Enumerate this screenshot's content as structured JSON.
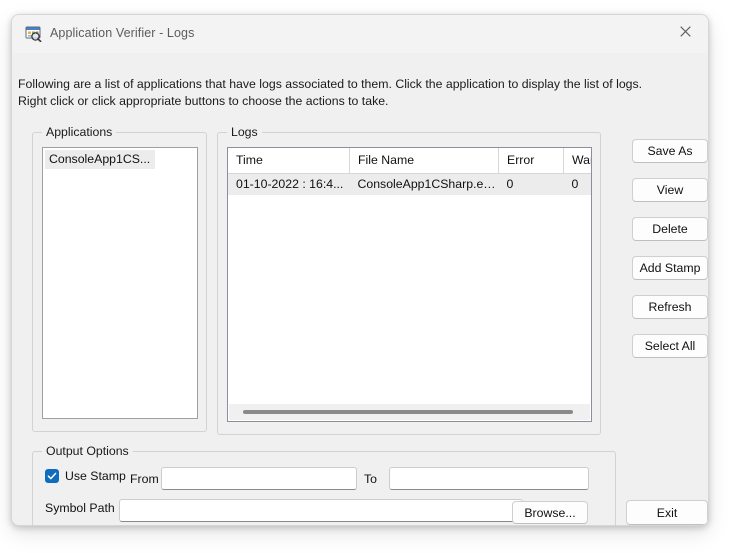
{
  "window": {
    "title": "Application Verifier - Logs",
    "icon": "application-verifier-icon",
    "close_label": "✕"
  },
  "intro": {
    "text": "Following are a list of applications that have logs associated to them. Click the application to display the list of logs. Right click or click appropriate buttons to choose the actions to take."
  },
  "applications": {
    "group_label": "Applications",
    "items": [
      {
        "label": "ConsoleApp1CS...",
        "selected": true
      }
    ]
  },
  "logs": {
    "group_label": "Logs",
    "columns": [
      "Time",
      "File Name",
      "Error",
      "Warning"
    ],
    "rows": [
      {
        "time": "01-10-2022 : 16:4...",
        "file_name": "ConsoleApp1CSharp.ex...",
        "error": "0",
        "warning": "0",
        "selected": true
      }
    ]
  },
  "side_buttons": [
    {
      "id": "save-as",
      "label": "Save As"
    },
    {
      "id": "view",
      "label": "View"
    },
    {
      "id": "delete",
      "label": "Delete"
    },
    {
      "id": "add-stamp",
      "label": "Add Stamp"
    },
    {
      "id": "refresh",
      "label": "Refresh"
    },
    {
      "id": "select-all",
      "label": "Select All"
    }
  ],
  "output_options": {
    "group_label": "Output Options",
    "use_stamp": {
      "label": "Use Stamp",
      "checked": true,
      "check_glyph": "✓"
    },
    "from": {
      "label": "From",
      "value": "",
      "placeholder": ""
    },
    "to": {
      "label": "To",
      "value": "",
      "placeholder": ""
    },
    "symbol_path": {
      "label": "Symbol Path",
      "value": "",
      "placeholder": ""
    },
    "browse_label": "Browse..."
  },
  "footer": {
    "exit_label": "Exit"
  },
  "colors": {
    "accent": "#0f6cbd",
    "window_bg": "#f0f0f0",
    "titlebar_bg": "#f3f3f3",
    "selection_bg": "#ececec",
    "title_text": "#5c5c5c"
  }
}
